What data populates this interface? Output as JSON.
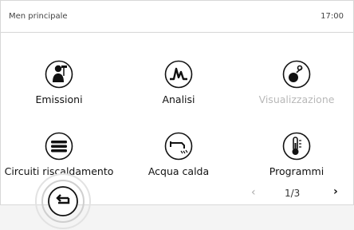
{
  "header": {
    "title": "Men principale",
    "time": "17:00"
  },
  "tiles": [
    {
      "label": "Emissioni",
      "icon": "chimney-sweep-icon",
      "enabled": true
    },
    {
      "label": "Analisi",
      "icon": "analysis-graph-icon",
      "enabled": true
    },
    {
      "label": "Visualizzazione",
      "icon": "visualization-icon",
      "enabled": false
    },
    {
      "label": "Circuiti riscaldamento",
      "icon": "radiator-icon",
      "enabled": true
    },
    {
      "label": "Acqua calda",
      "icon": "hot-water-tap-icon",
      "enabled": true
    },
    {
      "label": "Programmi",
      "icon": "thermometer-icon",
      "enabled": true
    }
  ],
  "pager": {
    "prev": "‹",
    "page": "1/3",
    "next": "›"
  },
  "colors": {
    "icon_stroke": "#111111",
    "disabled_text": "#b8b8b8"
  }
}
